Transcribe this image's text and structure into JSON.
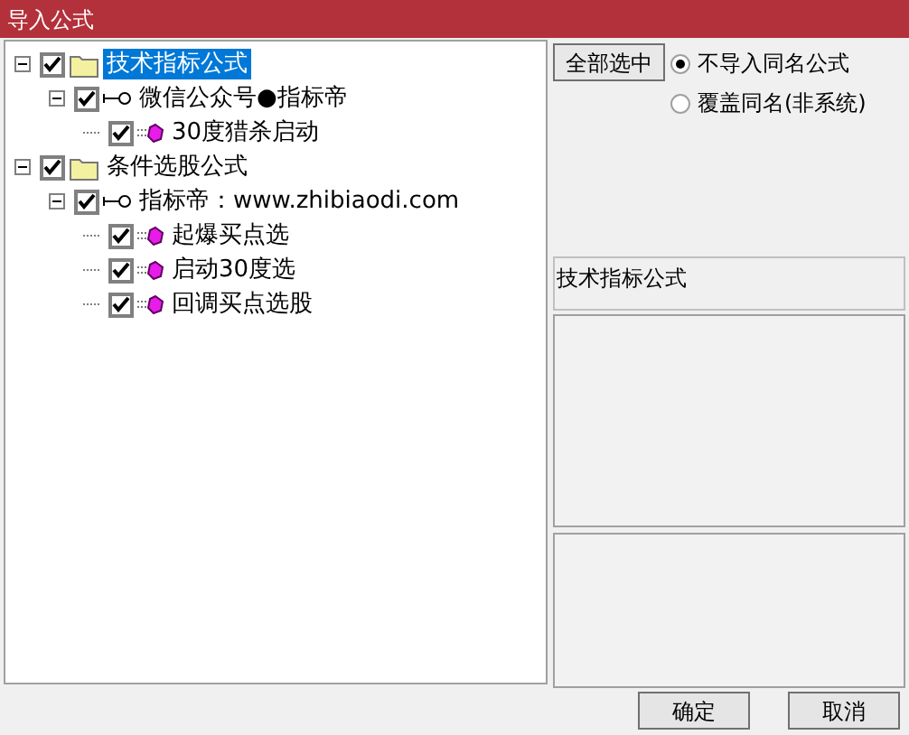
{
  "window": {
    "title": "导入公式"
  },
  "tree": [
    {
      "kind": "folder",
      "label": "技术指标公式",
      "checked": true,
      "expanded": true,
      "selected": true,
      "children": [
        {
          "kind": "group",
          "label": "微信公众号●指标帝",
          "checked": true,
          "expanded": true,
          "selected": false,
          "children": [
            {
              "kind": "formula",
              "label": "30度猎杀启动",
              "checked": true,
              "selected": false
            }
          ]
        }
      ]
    },
    {
      "kind": "folder",
      "label": "条件选股公式",
      "checked": true,
      "expanded": true,
      "selected": false,
      "children": [
        {
          "kind": "group",
          "label": "指标帝：www.zhibiaodi.com",
          "checked": true,
          "expanded": true,
          "selected": false,
          "children": [
            {
              "kind": "formula",
              "label": "起爆买点选",
              "checked": true,
              "selected": false
            },
            {
              "kind": "formula",
              "label": "启动30度选",
              "checked": true,
              "selected": false
            },
            {
              "kind": "formula",
              "label": "回调买点选股",
              "checked": true,
              "selected": false
            }
          ]
        }
      ]
    }
  ],
  "select_all_button": "全部选中",
  "options": [
    {
      "label": "不导入同名公式",
      "selected": true
    },
    {
      "label": "覆盖同名(非系统)",
      "selected": false
    }
  ],
  "info_box": "技术指标公式",
  "buttons": [
    "确定",
    "取消"
  ]
}
